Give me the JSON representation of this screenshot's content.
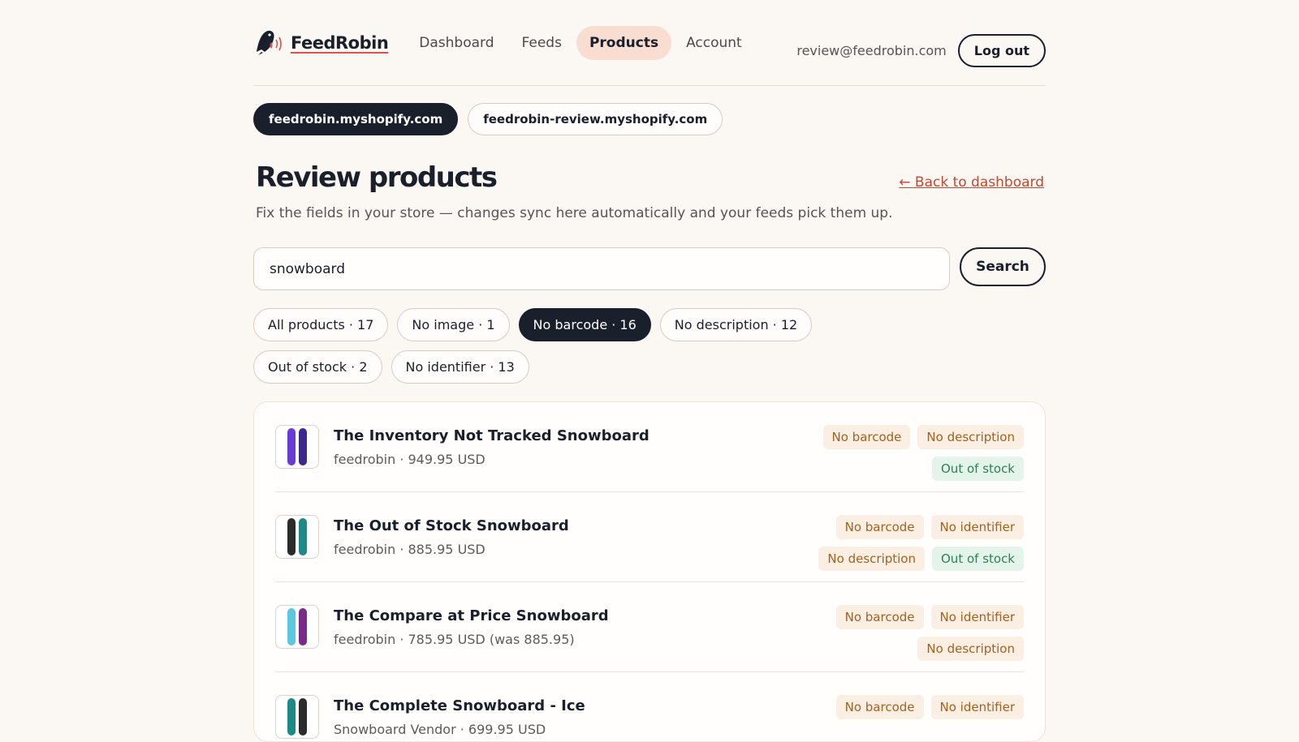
{
  "brand": {
    "name": "FeedRobin",
    "accent": "#d9534f"
  },
  "nav": [
    {
      "label": "Dashboard",
      "active": false
    },
    {
      "label": "Feeds",
      "active": false
    },
    {
      "label": "Products",
      "active": true
    },
    {
      "label": "Account",
      "active": false
    }
  ],
  "user": {
    "email": "review@feedrobin.com",
    "logout_label": "Log out"
  },
  "stores": [
    {
      "label": "feedrobin.myshopify.com",
      "active": true
    },
    {
      "label": "feedrobin-review.myshopify.com",
      "active": false
    }
  ],
  "page": {
    "title": "Review products",
    "back_link": "← Back to dashboard",
    "subtitle": "Fix the fields in your store — changes sync here automatically and your feeds pick them up."
  },
  "search": {
    "value": "snowboard",
    "button_label": "Search"
  },
  "filters": [
    {
      "label": "All products · 17",
      "active": false
    },
    {
      "label": "No image · 1",
      "active": false
    },
    {
      "label": "No barcode · 16",
      "active": true
    },
    {
      "label": "No description · 12",
      "active": false
    },
    {
      "label": "Out of stock · 2",
      "active": false
    },
    {
      "label": "No identifier · 13",
      "active": false
    }
  ],
  "products": [
    {
      "name": "The Inventory Not Tracked Snowboard",
      "meta": "feedrobin · 949.95 USD",
      "colors": [
        "#6a3bd6",
        "#3b2a8c"
      ],
      "badges": [
        {
          "label": "No barcode",
          "kind": "warn"
        },
        {
          "label": "No description",
          "kind": "warn"
        },
        {
          "label": "Out of stock",
          "kind": "stock"
        }
      ]
    },
    {
      "name": "The Out of Stock Snowboard",
      "meta": "feedrobin · 885.95 USD",
      "colors": [
        "#2b2b2b",
        "#1d8a88"
      ],
      "badges": [
        {
          "label": "No barcode",
          "kind": "warn"
        },
        {
          "label": "No identifier",
          "kind": "warn"
        },
        {
          "label": "No description",
          "kind": "warn"
        },
        {
          "label": "Out of stock",
          "kind": "stock"
        }
      ]
    },
    {
      "name": "The Compare at Price Snowboard",
      "meta": "feedrobin · 785.95 USD (was 885.95)",
      "colors": [
        "#5cc8e0",
        "#7a2a8a"
      ],
      "badges": [
        {
          "label": "No barcode",
          "kind": "warn"
        },
        {
          "label": "No identifier",
          "kind": "warn"
        },
        {
          "label": "No description",
          "kind": "warn"
        }
      ]
    },
    {
      "name": "The Complete Snowboard - Ice",
      "meta": "Snowboard Vendor · 699.95 USD",
      "colors": [
        "#1d8a88",
        "#2b2b2b"
      ],
      "badges": [
        {
          "label": "No barcode",
          "kind": "warn"
        },
        {
          "label": "No identifier",
          "kind": "warn"
        }
      ]
    }
  ]
}
